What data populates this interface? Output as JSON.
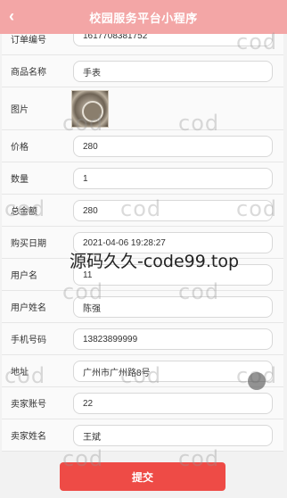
{
  "header": {
    "title": "校园服务平台小程序",
    "back_icon": "chevron-left-icon"
  },
  "form": {
    "order_no": {
      "label": "订单编号",
      "value": "1617708381752"
    },
    "product_name": {
      "label": "商品名称",
      "value": "手表"
    },
    "image": {
      "label": "图片"
    },
    "price": {
      "label": "价格",
      "value": "280"
    },
    "quantity": {
      "label": "数量",
      "value": "1"
    },
    "total": {
      "label": "总金额",
      "value": "280"
    },
    "purchase_date": {
      "label": "购买日期",
      "value": "2021-04-06 19:28:27"
    },
    "username": {
      "label": "用户名",
      "value": "11"
    },
    "user_fullname": {
      "label": "用户姓名",
      "value": "陈强"
    },
    "phone": {
      "label": "手机号码",
      "value": "13823899999"
    },
    "address": {
      "label": "地址",
      "value": "广州市广州路8号"
    },
    "seller_account": {
      "label": "卖家账号",
      "value": "22"
    },
    "seller_name": {
      "label": "卖家姓名",
      "value": "王斌"
    }
  },
  "submit_label": "提交",
  "watermark": {
    "repeat": "cod",
    "center": "源码久久-code99.top"
  },
  "colors": {
    "header": "#f3a6a6",
    "submit": "#ee4b46"
  }
}
